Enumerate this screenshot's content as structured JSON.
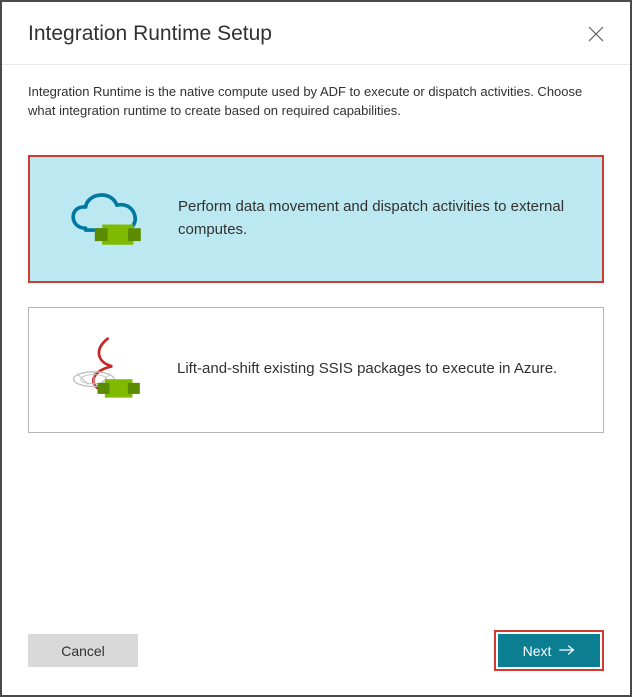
{
  "header": {
    "title": "Integration Runtime Setup"
  },
  "intro": {
    "text": "Integration Runtime is the native compute used by ADF to execute or dispatch activities. Choose what integration runtime to create based on required capabilities."
  },
  "options": [
    {
      "label": "Perform data movement and dispatch activities to external computes.",
      "selected": true
    },
    {
      "label": "Lift-and-shift existing SSIS packages to execute in Azure.",
      "selected": false
    }
  ],
  "footer": {
    "cancel_label": "Cancel",
    "next_label": "Next"
  }
}
